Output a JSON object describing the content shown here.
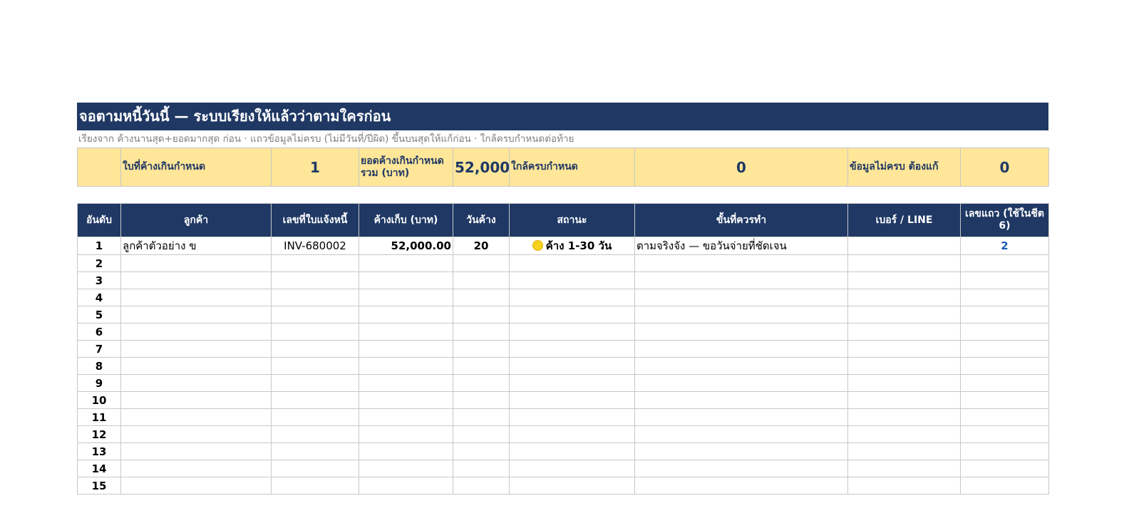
{
  "title": "จอตามหนี้วันนี้ — ระบบเรียงให้แล้วว่าตามใครก่อน",
  "subtitle": "เรียงจาก ค้างนานสุด+ยอดมากสุด ก่อน · แถวข้อมูลไม่ครบ (ไม่มีวันที่/ปีผิด) ขึ้นบนสุดให้แก้ก่อน · ใกล้ครบกำหนดต่อท้าย",
  "kpis": {
    "overdue_count_label": "ใบที่ค้างเกินกำหนด",
    "overdue_count_value": "1",
    "overdue_total_label": "ยอดค้างเกินกำหนด รวม (บาท)",
    "overdue_total_value": "52,000",
    "near_due_label": "ใกล้ครบกำหนด",
    "near_due_value": "0",
    "incomplete_label": "ข้อมูลไม่ครบ ต้องแก้",
    "incomplete_value": "0"
  },
  "columns": [
    "อันดับ",
    "ลูกค้า",
    "เลขที่ใบแจ้งหนี้",
    "ค้างเก็บ (บาท)",
    "วันค้าง",
    "สถานะ",
    "ขั้นที่ควรทำ",
    "เบอร์ / LINE",
    "เลขแถว (ใช้ในชีต 6)"
  ],
  "rows": [
    {
      "rank": "1",
      "customer": "ลูกค้าตัวอย่าง ข",
      "invoice": "INV-680002",
      "amount": "52,000.00",
      "days": "20",
      "status": "ค้าง 1-30 วัน",
      "status_icon": "yellow-circle",
      "status_color": "#f7d21e",
      "step": "ตามจริงจัง — ขอวันจ่ายที่ชัดเจน",
      "contact": "",
      "sheet_row": "2"
    },
    {
      "rank": "2"
    },
    {
      "rank": "3"
    },
    {
      "rank": "4"
    },
    {
      "rank": "5"
    },
    {
      "rank": "6"
    },
    {
      "rank": "7"
    },
    {
      "rank": "8"
    },
    {
      "rank": "9"
    },
    {
      "rank": "10"
    },
    {
      "rank": "11"
    },
    {
      "rank": "12"
    },
    {
      "rank": "13"
    },
    {
      "rank": "14"
    },
    {
      "rank": "15"
    }
  ],
  "colors": {
    "header_bg": "#1f3864",
    "kpi_bg": "#ffe699",
    "link_blue": "#1a5fb4"
  }
}
